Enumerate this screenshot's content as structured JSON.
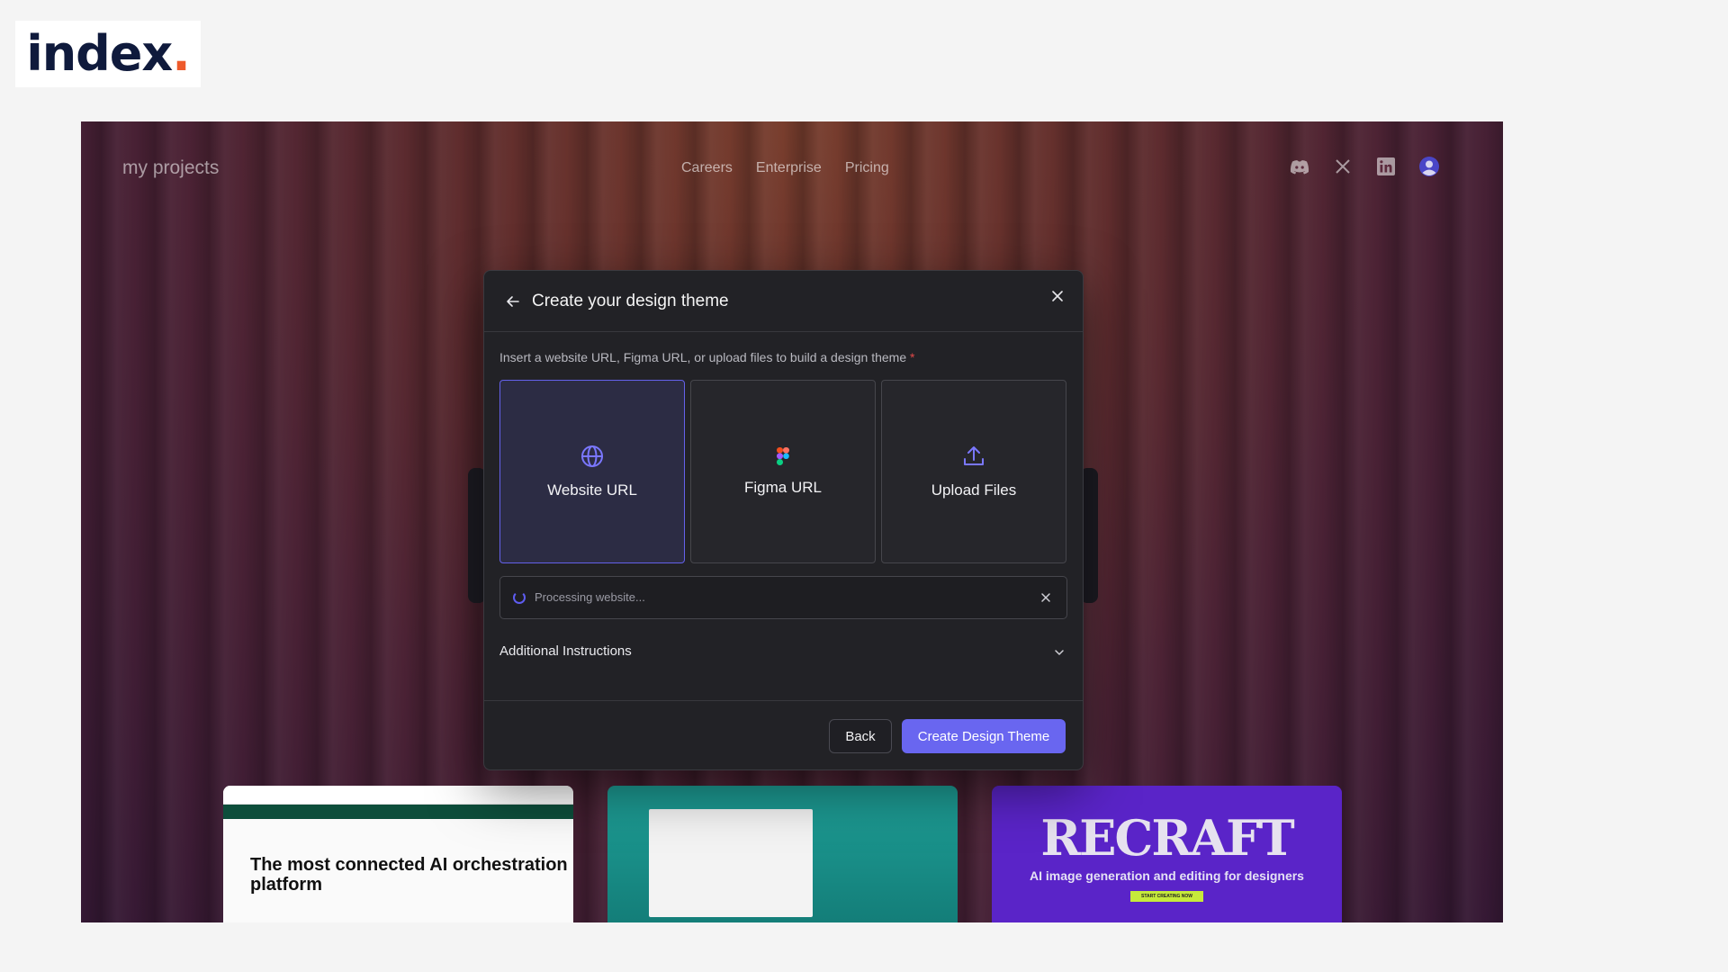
{
  "logo": {
    "text": "index",
    "dot": "."
  },
  "app": {
    "brand": "my projects",
    "nav": [
      "Careers",
      "Enterprise",
      "Pricing"
    ],
    "socials": [
      "discord-icon",
      "x-icon",
      "linkedin-icon",
      "user-avatar"
    ]
  },
  "modal": {
    "title": "Create your design theme",
    "instruction": "Insert a website URL, Figma URL, or upload files to build a design theme",
    "required_mark": "*",
    "options": [
      {
        "label": "Website URL",
        "icon": "globe-icon",
        "selected": true
      },
      {
        "label": "Figma URL",
        "icon": "figma-icon",
        "selected": false
      },
      {
        "label": "Upload Files",
        "icon": "upload-icon",
        "selected": false
      }
    ],
    "processing_text": "Processing website...",
    "additional_instructions": "Additional Instructions",
    "back_label": "Back",
    "create_label": "Create Design Theme"
  },
  "thumbnails": {
    "t1_heading": "The most connected AI orchestration platform",
    "t3_big": "RECRAFT",
    "t3_sub": "AI image generation and editing for designers",
    "t3_cta": "START CREATING NOW"
  },
  "colors": {
    "accent": "#6966f0",
    "logo_dot": "#ee5a2b",
    "modal_bg": "#222226"
  }
}
